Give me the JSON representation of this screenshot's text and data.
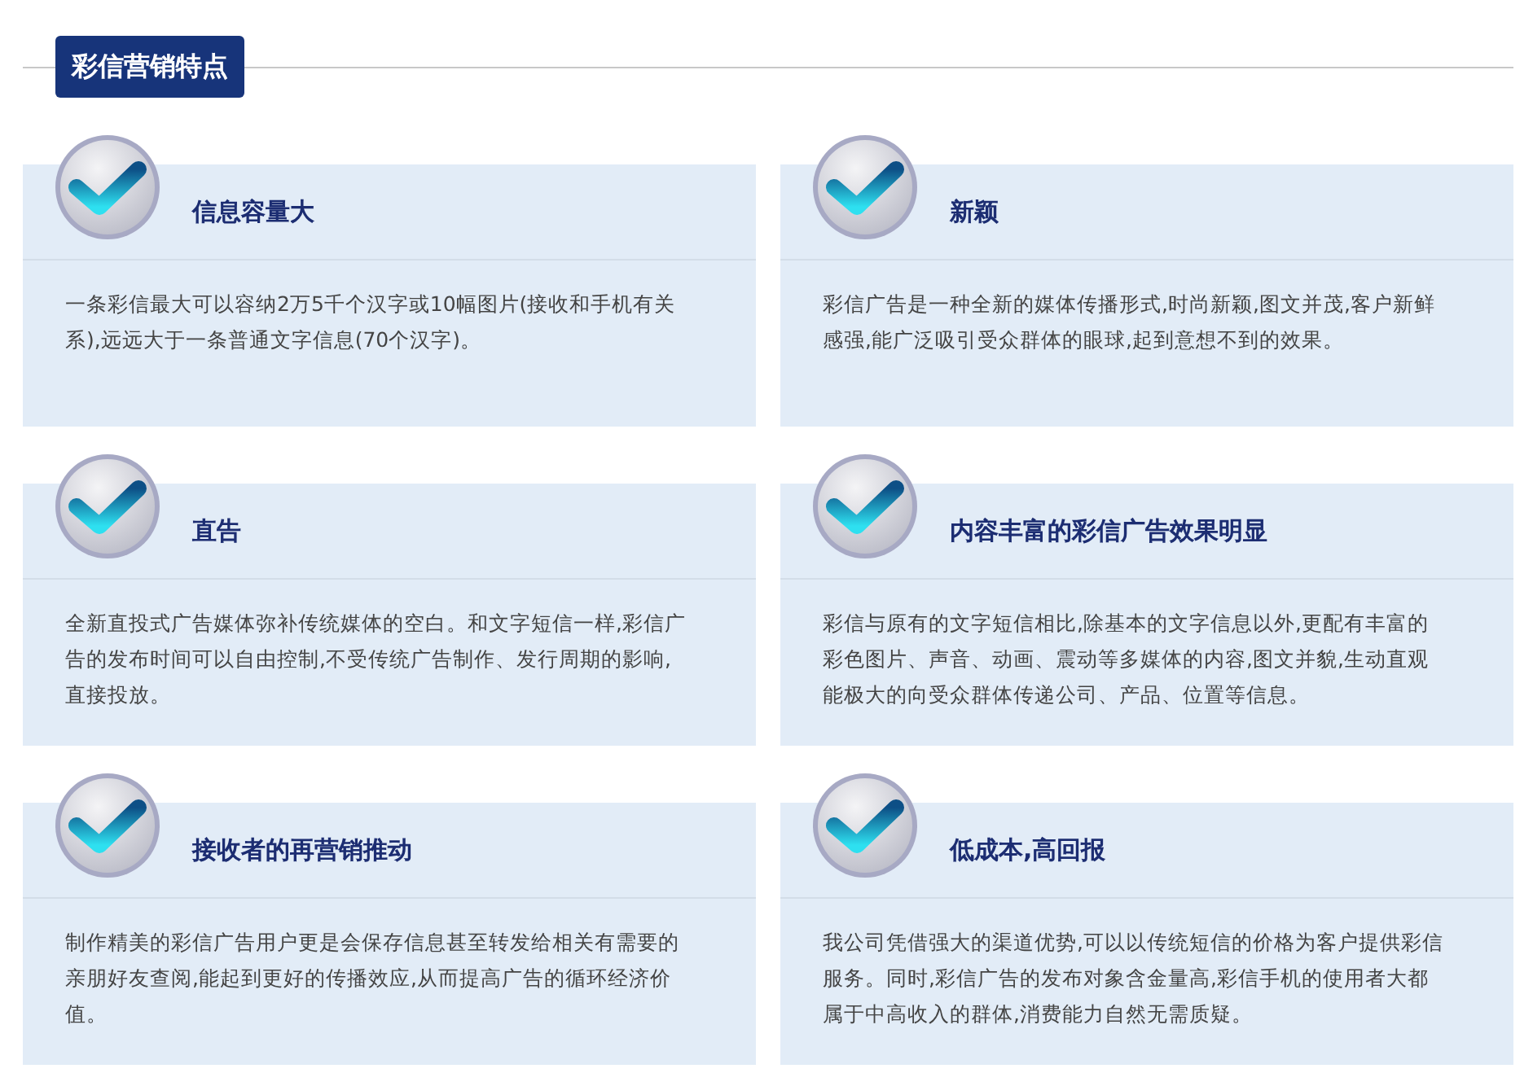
{
  "section_title": "彩信营销特点",
  "features": [
    {
      "title": "信息容量大",
      "text": "一条彩信最大可以容纳2万5千个汉字或10幅图片(接收和手机有关系),远远大于一条普通文字信息(70个汉字)。"
    },
    {
      "title": "新颖",
      "text": "彩信广告是一种全新的媒体传播形式,时尚新颖,图文并茂,客户新鲜感强,能广泛吸引受众群体的眼球,起到意想不到的效果。"
    },
    {
      "title": "直告",
      "text": "全新直投式广告媒体弥补传统媒体的空白。和文字短信一样,彩信广告的发布时间可以自由控制,不受传统广告制作、发行周期的影响,直接投放。"
    },
    {
      "title": "内容丰富的彩信广告效果明显",
      "text": "彩信与原有的文字短信相比,除基本的文字信息以外,更配有丰富的彩色图片、声音、动画、震动等多媒体的内容,图文并貌,生动直观能极大的向受众群体传递公司、产品、位置等信息。"
    },
    {
      "title": "接收者的再营销推动",
      "text": "制作精美的彩信广告用户更是会保存信息甚至转发给相关有需要的亲朋好友查阅,能起到更好的传播效应,从而提高广告的循环经济价值。"
    },
    {
      "title": "低成本,高回报",
      "text": "我公司凭借强大的渠道优势,可以以传统短信的价格为客户提供彩信服务。同时,彩信广告的发布对象含金量高,彩信手机的使用者大都属于中高收入的群体,消费能力自然无需质疑。"
    }
  ]
}
